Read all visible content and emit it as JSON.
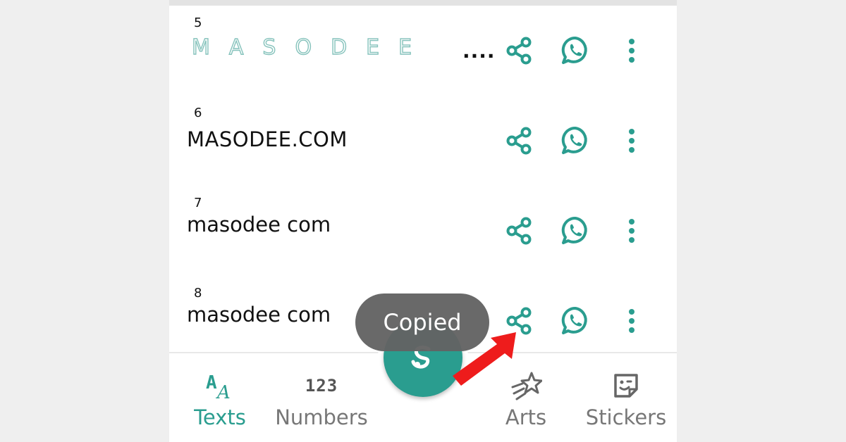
{
  "list": {
    "rows": [
      {
        "num": "5",
        "text": "MASODEE",
        "ellipsis": "...."
      },
      {
        "num": "6",
        "text": "MASODEE.COM"
      },
      {
        "num": "7",
        "text": "masodee com"
      },
      {
        "num": "8",
        "text": "masodee com"
      }
    ]
  },
  "toast": {
    "text": "Copied"
  },
  "nav": {
    "items": [
      {
        "label": "Texts",
        "glyph": "AA",
        "active": true
      },
      {
        "label": "Numbers",
        "glyph": "123"
      },
      {
        "label": "Arts"
      },
      {
        "label": "Stickers"
      }
    ]
  },
  "colors": {
    "accent": "#2a9d8f",
    "outline": "#86c3bc",
    "toast": "#636363",
    "arrow": "#ee1c1c",
    "inactive": "#777777"
  },
  "icons": [
    "share-icon",
    "whatsapp-icon",
    "more-vert-icon",
    "texts-icon",
    "numbers-icon",
    "arts-icon",
    "stickers-icon",
    "fab-logo-icon",
    "arrow-annotation"
  ]
}
